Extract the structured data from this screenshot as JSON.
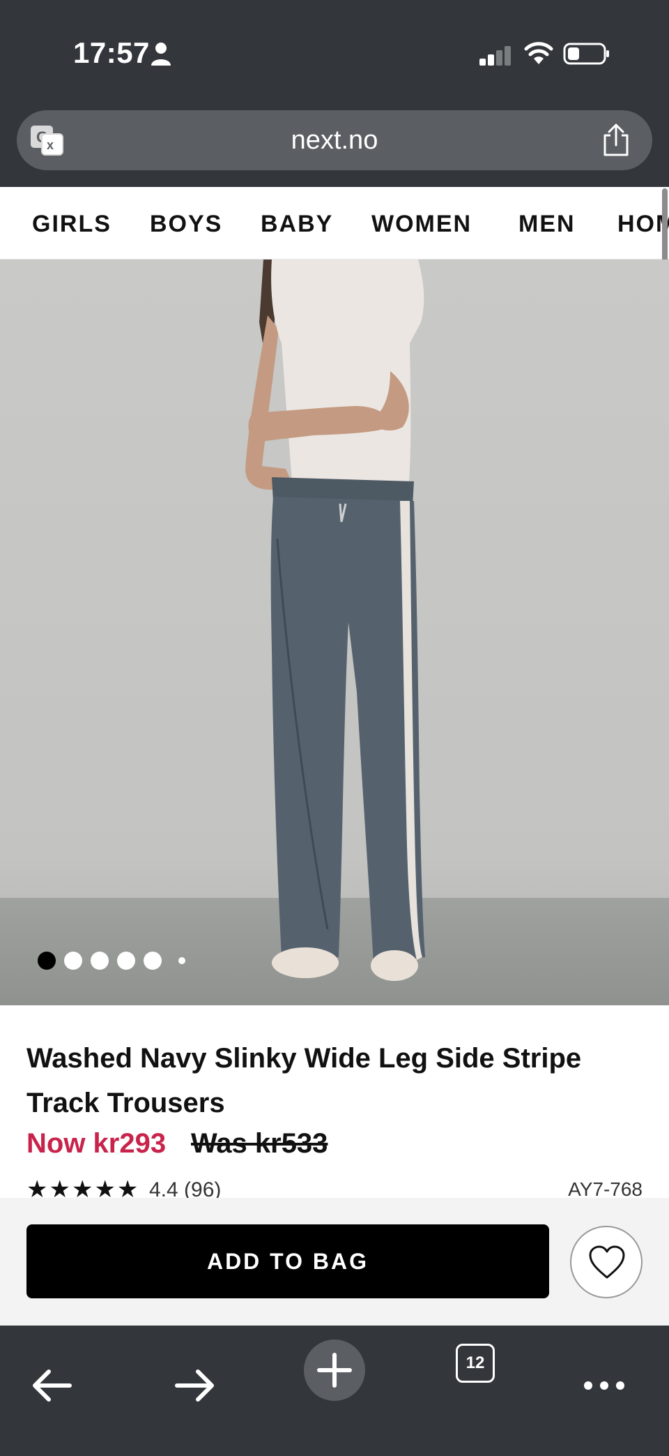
{
  "status_bar": {
    "time": "17:57"
  },
  "browser": {
    "url": "next.no",
    "tab_count": "12"
  },
  "nav": {
    "categories": [
      "GIRLS",
      "BOYS",
      "BABY",
      "WOMEN",
      "MEN",
      "HOME"
    ]
  },
  "gallery": {
    "slide_count": 6,
    "active_index": 0
  },
  "product": {
    "title": "Washed Navy Slinky Wide Leg Side Stripe Track Trousers",
    "price_now": "Now kr293",
    "price_was": "Was kr533",
    "stars": "★★★★★",
    "rating": "4.4 (96)",
    "sku": "AY7-768"
  },
  "actions": {
    "add_to_bag": "ADD TO BAG"
  },
  "colors": {
    "sale_red": "#c8234b",
    "chrome_dark": "#33373b"
  },
  "icons": [
    "person-icon",
    "signal-icon",
    "wifi-icon",
    "battery-icon",
    "translate-icon",
    "share-icon",
    "heart-icon",
    "back-arrow-icon",
    "forward-arrow-icon",
    "plus-icon",
    "tabs-icon",
    "more-icon"
  ]
}
